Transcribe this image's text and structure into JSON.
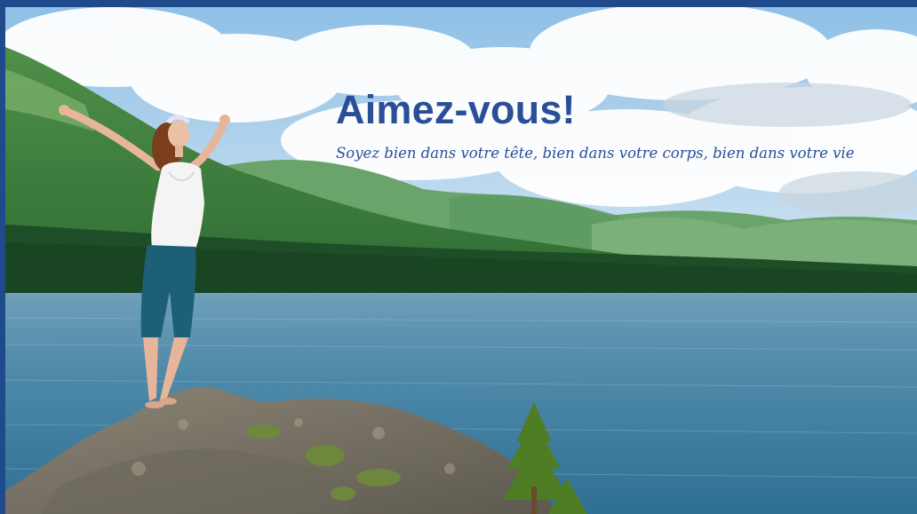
{
  "hero": {
    "title": "Aimez-vous!",
    "subtitle": "Soyez bien dans votre tête, bien dans votre corps, bien dans votre vie",
    "image_subject": "woman-arms-raised-on-rock-by-mountain-lake"
  },
  "colors": {
    "frame": "#1f4a8c",
    "headline": "#2a4f97",
    "sky": "#9cc8ea",
    "water": "#3f7fa3",
    "forest": "#1f5a2c"
  }
}
